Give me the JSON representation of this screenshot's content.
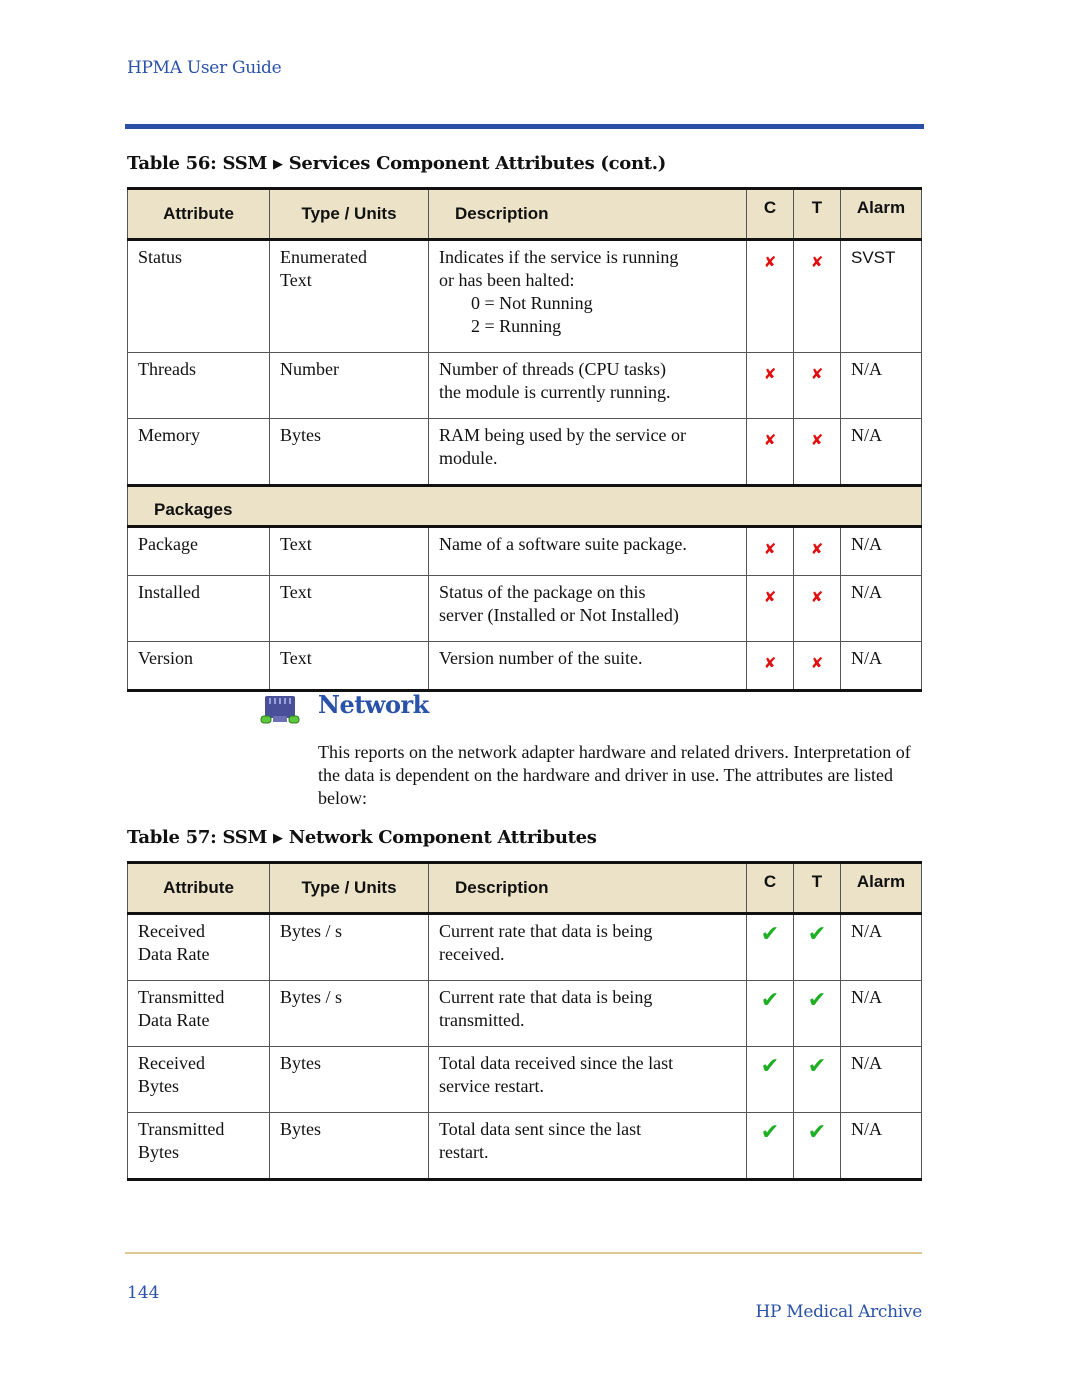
{
  "header": {
    "running_title": "HPMA User Guide"
  },
  "table56": {
    "caption_prefix": "Table 56: SSM",
    "caption_arrow": "▶",
    "caption_suffix": "Services Component Attributes (cont.)",
    "columns": [
      "Attribute",
      "Type / Units",
      "Description",
      "C",
      "T",
      "Alarm"
    ],
    "rows": [
      {
        "attribute": [
          "Status"
        ],
        "type": [
          "Enumerated",
          "Text"
        ],
        "description": [
          "Indicates if the service is running",
          "or has been halted:"
        ],
        "description_values": [
          "0 = Not Running",
          "2 = Running"
        ],
        "c": "cross-icon",
        "t": "cross-icon",
        "alarm": "SVST"
      },
      {
        "attribute": [
          "Threads"
        ],
        "type": [
          "Number"
        ],
        "description": [
          "Number of threads (CPU tasks)",
          "the module is currently running."
        ],
        "c": "cross-icon",
        "t": "cross-icon",
        "alarm": "N/A"
      },
      {
        "attribute": [
          "Memory"
        ],
        "type": [
          "Bytes"
        ],
        "description": [
          "RAM being used by the service or",
          "module."
        ],
        "c": "cross-icon",
        "t": "cross-icon",
        "alarm": "N/A"
      }
    ],
    "section_label": "Packages",
    "section_rows": [
      {
        "attribute": [
          "Package"
        ],
        "type": [
          "Text"
        ],
        "description": [
          "Name of a software suite package."
        ],
        "c": "cross-icon",
        "t": "cross-icon",
        "alarm": "N/A"
      },
      {
        "attribute": [
          "Installed"
        ],
        "type": [
          "Text"
        ],
        "description": [
          "Status of the package on this",
          "server (Installed or Not Installed)"
        ],
        "c": "cross-icon",
        "t": "cross-icon",
        "alarm": "N/A"
      },
      {
        "attribute": [
          "Version"
        ],
        "type": [
          "Text"
        ],
        "description": [
          "Version number of the suite."
        ],
        "c": "cross-icon",
        "t": "cross-icon",
        "alarm": "N/A"
      }
    ]
  },
  "network_section": {
    "icon": "network-adapter-icon",
    "title": "Network",
    "body": "This reports on the network adapter hardware and related drivers. Interpretation of the data is dependent on the hardware and driver in use. The attributes are listed below:"
  },
  "table57": {
    "caption_prefix": "Table 57: SSM",
    "caption_arrow": "▶",
    "caption_suffix": "Network Component Attributes",
    "columns": [
      "Attribute",
      "Type / Units",
      "Description",
      "C",
      "T",
      "Alarm"
    ],
    "rows": [
      {
        "attribute": [
          "Received",
          "Data Rate"
        ],
        "type": [
          "Bytes / s"
        ],
        "description": [
          "Current rate that data is being",
          "received."
        ],
        "c": "check-icon",
        "t": "check-icon",
        "alarm": "N/A"
      },
      {
        "attribute": [
          "Transmitted",
          "Data Rate"
        ],
        "type": [
          "Bytes / s"
        ],
        "description": [
          "Current rate that data is being",
          "transmitted."
        ],
        "c": "check-icon",
        "t": "check-icon",
        "alarm": "N/A"
      },
      {
        "attribute": [
          "Received",
          "Bytes"
        ],
        "type": [
          "Bytes"
        ],
        "description": [
          "Total data received since the last",
          "service restart."
        ],
        "c": "check-icon",
        "t": "check-icon",
        "alarm": "N/A"
      },
      {
        "attribute": [
          "Transmitted",
          "Bytes"
        ],
        "type": [
          "Bytes"
        ],
        "description": [
          "Total data sent since the last",
          "restart."
        ],
        "c": "check-icon",
        "t": "check-icon",
        "alarm": "N/A"
      }
    ]
  },
  "footer": {
    "page_number": "144",
    "doc_title": "HP Medical Archive"
  },
  "colors": {
    "accent_blue": "#2a52a8",
    "header_tan": "#ebe2c8",
    "cross_red": "#e01010",
    "check_green": "#1fae24"
  },
  "glyphs": {
    "cross-icon": "✘",
    "check-icon": "✔"
  }
}
